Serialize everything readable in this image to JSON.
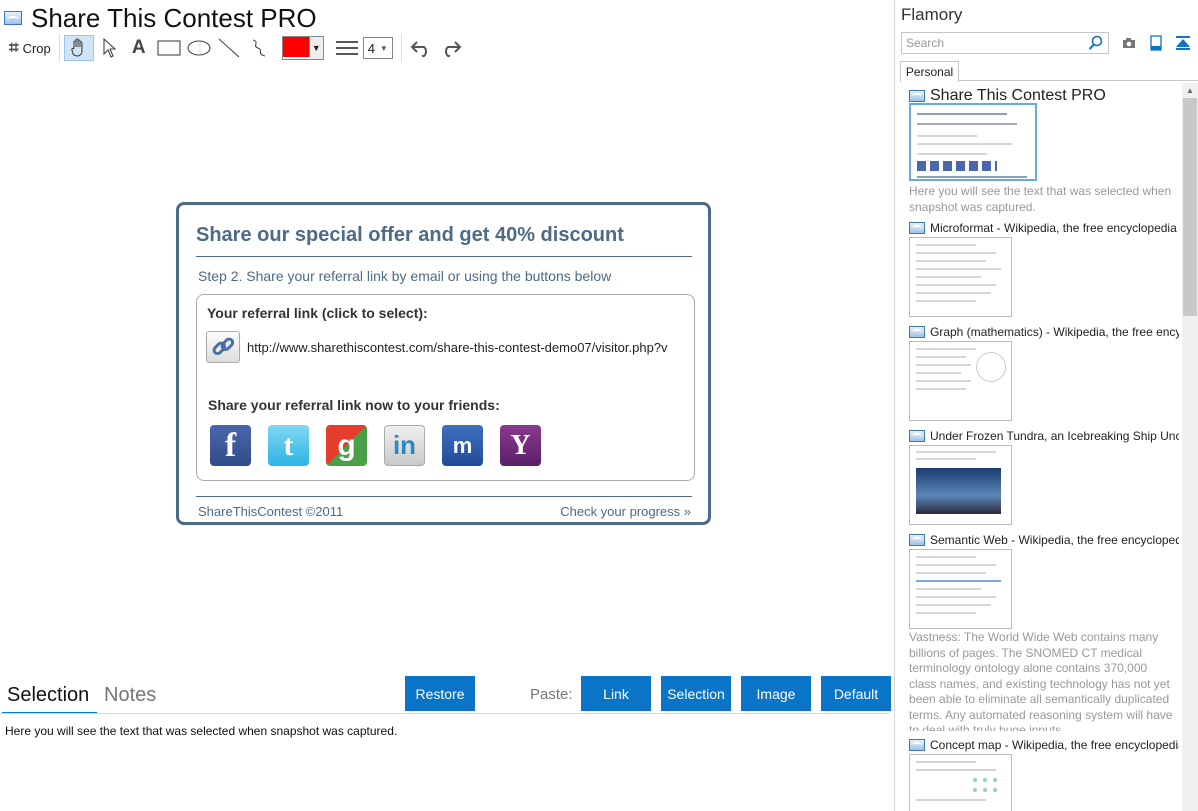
{
  "window": {
    "title": "Share This Contest PRO"
  },
  "toolbar": {
    "crop_label": "Crop",
    "tools": [
      "hand-icon",
      "pointer-icon",
      "text-icon",
      "rectangle-icon",
      "ellipse-icon",
      "line-icon",
      "freehand-icon"
    ],
    "active_tool": "hand-icon",
    "text_tool_glyph": "A",
    "color": "#ff0000",
    "line_width": "4"
  },
  "widget": {
    "heading": "Share our special offer and get 40% discount",
    "step": "Step 2. Share your referral link by email or using the buttons below",
    "referral_label": "Your referral link (click to select):",
    "url": "http://www.sharethiscontest.com/share-this-contest-demo07/visitor.php?v",
    "share_label": "Share your referral link now to your friends:",
    "social": [
      {
        "name": "facebook-button",
        "glyph": "f"
      },
      {
        "name": "twitter-button",
        "glyph": "t"
      },
      {
        "name": "google-button",
        "glyph": "g"
      },
      {
        "name": "linkedin-button",
        "glyph": "in"
      },
      {
        "name": "myspace-button",
        "glyph": "m"
      },
      {
        "name": "yahoo-button",
        "glyph": "Y"
      }
    ],
    "copyright": "ShareThisContest ©2011",
    "progress_link": "Check your progress »",
    "accent": "#4d6a87"
  },
  "bottom": {
    "tabs": [
      "Selection",
      "Notes"
    ],
    "active_tab": "Selection",
    "restore": "Restore",
    "paste_label": "Paste:",
    "paste_buttons": [
      "Link",
      "Selection",
      "Image",
      "Default"
    ],
    "selection_text": "Here you will see the text that was selected when snapshot was captured.",
    "button_color": "#0a74c7"
  },
  "sidebar": {
    "app_name": "Flamory",
    "search_placeholder": "Search",
    "tab": "Personal",
    "snapshots": [
      {
        "title": "Share This Contest PRO",
        "description": "Here you will see the text that was selected when snapshot was captured."
      },
      {
        "title": "Microformat - Wikipedia, the free encyclopedia",
        "description": ""
      },
      {
        "title": "Graph (mathematics) - Wikipedia, the free ency",
        "description": ""
      },
      {
        "title": "Under Frozen Tundra, an Icebreaking Ship Unco",
        "description": ""
      },
      {
        "title": "Semantic Web - Wikipedia, the free encycloped",
        "description": "Vastness: The World Wide Web contains many billions of pages. The SNOMED CT medical terminology ontology alone contains 370,000 class names, and existing technology has not yet been able to eliminate all semantically duplicated terms. Any automated reasoning system will have to deal with truly huge inputs."
      },
      {
        "title": "Concept map - Wikipedia, the free encyclopedia",
        "description": ""
      }
    ]
  }
}
